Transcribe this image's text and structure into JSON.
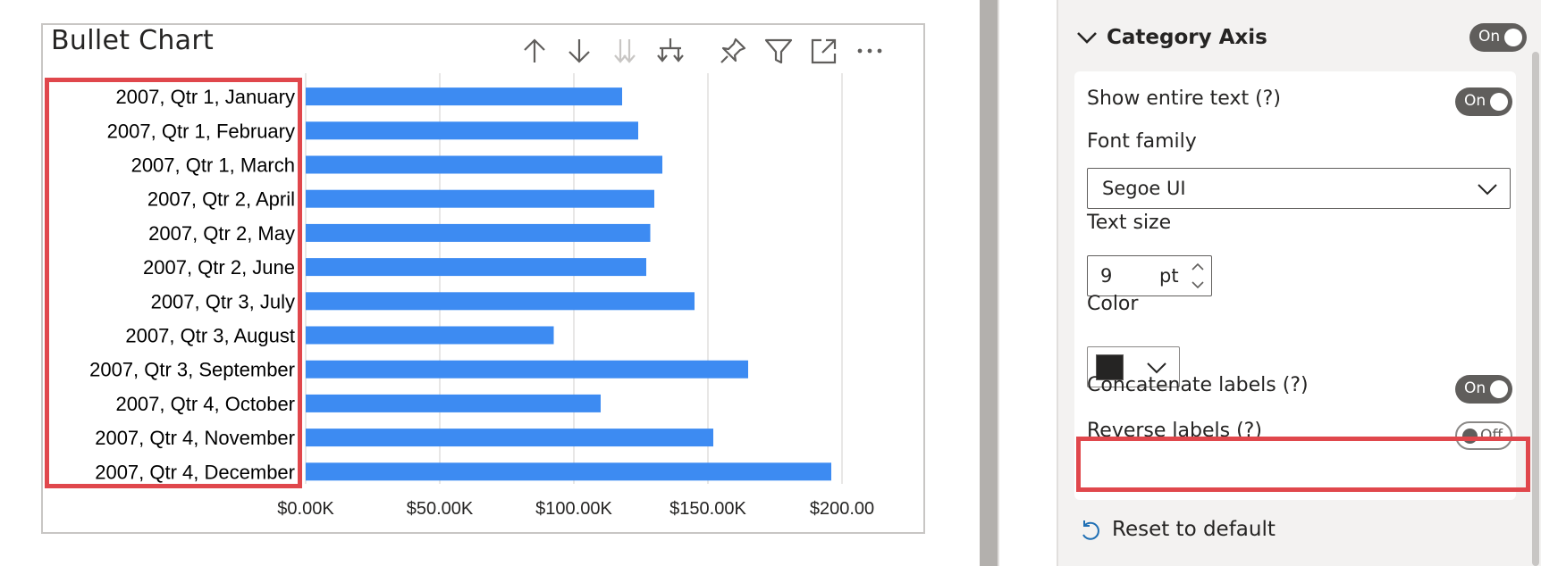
{
  "visual": {
    "title": "Bullet Chart",
    "header_icons": [
      "arrow-up-icon",
      "arrow-down-icon",
      "double-arrow-down-icon",
      "expand-hierarchy-icon",
      "pin-icon",
      "filter-icon",
      "focus-mode-icon",
      "more-options-icon"
    ]
  },
  "chart_data": {
    "type": "bar",
    "orientation": "horizontal",
    "title": "Bullet Chart",
    "categories": [
      "2007, Qtr 1, January",
      "2007, Qtr 1, February",
      "2007, Qtr 1, March",
      "2007, Qtr 2, April",
      "2007, Qtr 2, May",
      "2007, Qtr 2, June",
      "2007, Qtr 3, July",
      "2007, Qtr 3, August",
      "2007, Qtr 3, September",
      "2007, Qtr 4, October",
      "2007, Qtr 4, November",
      "2007, Qtr 4, December"
    ],
    "values": [
      118000,
      124000,
      133000,
      130000,
      128500,
      127000,
      145000,
      92500,
      165000,
      110000,
      152000,
      196000
    ],
    "x_ticks": [
      "$0.00K",
      "$50.00K",
      "$100.00K",
      "$150.00K",
      "$200.00"
    ],
    "xlim": [
      0,
      200000
    ],
    "grid": true,
    "bar_color": "#3d8bf2",
    "grid_color": "#e1dfdd"
  },
  "pane": {
    "section_title": "Category Axis",
    "section_toggle": "On",
    "show_entire_text": {
      "label": "Show entire text (?)",
      "state": "On"
    },
    "font_family": {
      "label": "Font family",
      "value": "Segoe UI"
    },
    "text_size": {
      "label": "Text size",
      "value": "9",
      "unit": "pt"
    },
    "color": {
      "label": "Color",
      "swatch": "#252423"
    },
    "concatenate_labels": {
      "label": "Concatenate labels (?)",
      "state": "On"
    },
    "reverse_labels": {
      "label": "Reverse labels (?)",
      "state": "Off"
    },
    "reset_label": "Reset to default"
  },
  "highlight_color": "#e0474c"
}
